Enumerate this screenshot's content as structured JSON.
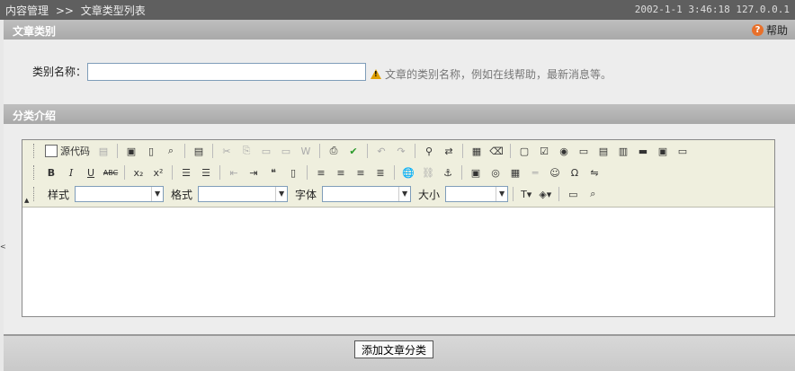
{
  "breadcrumb": {
    "root": "内容管理",
    "sep": ">>",
    "current": "文章类型列表"
  },
  "status": {
    "date": "2002-1-1",
    "time": "3:46:18",
    "ip": "127.0.0.1"
  },
  "category_section": {
    "title": "文章类别",
    "help_label": "帮助"
  },
  "category_name": {
    "label": "类别名称：",
    "value": "",
    "hint": "文章的类别名称，例如在线帮助，最新消息等。"
  },
  "intro_section": {
    "title": "分类介绍"
  },
  "editor": {
    "source_label": "源代码",
    "style_label": "样式",
    "format_label": "格式",
    "font_label": "字体",
    "size_label": "大小"
  },
  "submit_label": "添加文章分类"
}
